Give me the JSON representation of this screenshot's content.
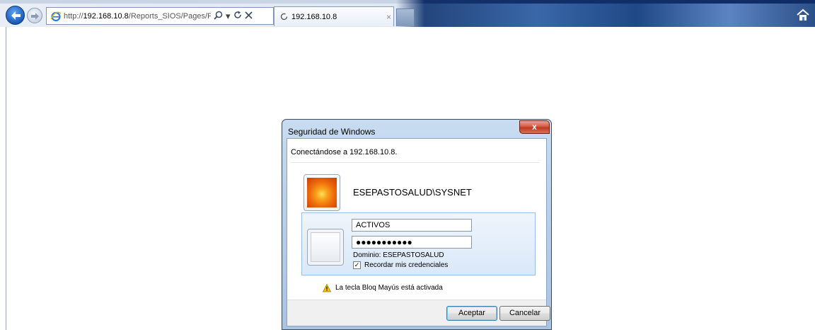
{
  "browser": {
    "address_url_prefix": "http://",
    "address_url_host": "192.168.10.8",
    "address_url_path": "/Reports_SIOS/Pages/Folder.asp:",
    "search_icon": "magnifier-icon",
    "refresh_icon": "refresh-icon",
    "stop_icon": "stop-icon",
    "tab_title": "192.168.10.8",
    "tab_close": "×",
    "dropdown_glyph": "▾"
  },
  "dialog": {
    "title": "Seguridad de Windows",
    "close_label": "x",
    "connecting_text": "Conectándose a 192.168.10.8.",
    "saved_user": "ESEPASTOSALUD\\SYSNET",
    "username_value": "ACTIVOS",
    "password_mask": "●●●●●●●●●●●",
    "domain_text": "Dominio: ESEPASTOSALUD",
    "remember_checked": "✓",
    "remember_label": "Recordar mis credenciales",
    "capslock_warning": "La tecla Bloq Mayús está activada",
    "ok_label": "Aceptar",
    "cancel_label": "Cancelar"
  },
  "colors": {
    "titlebar_accent": "#3a67a8",
    "close_button": "#c0391f",
    "default_button_border": "#3c7fb1"
  }
}
